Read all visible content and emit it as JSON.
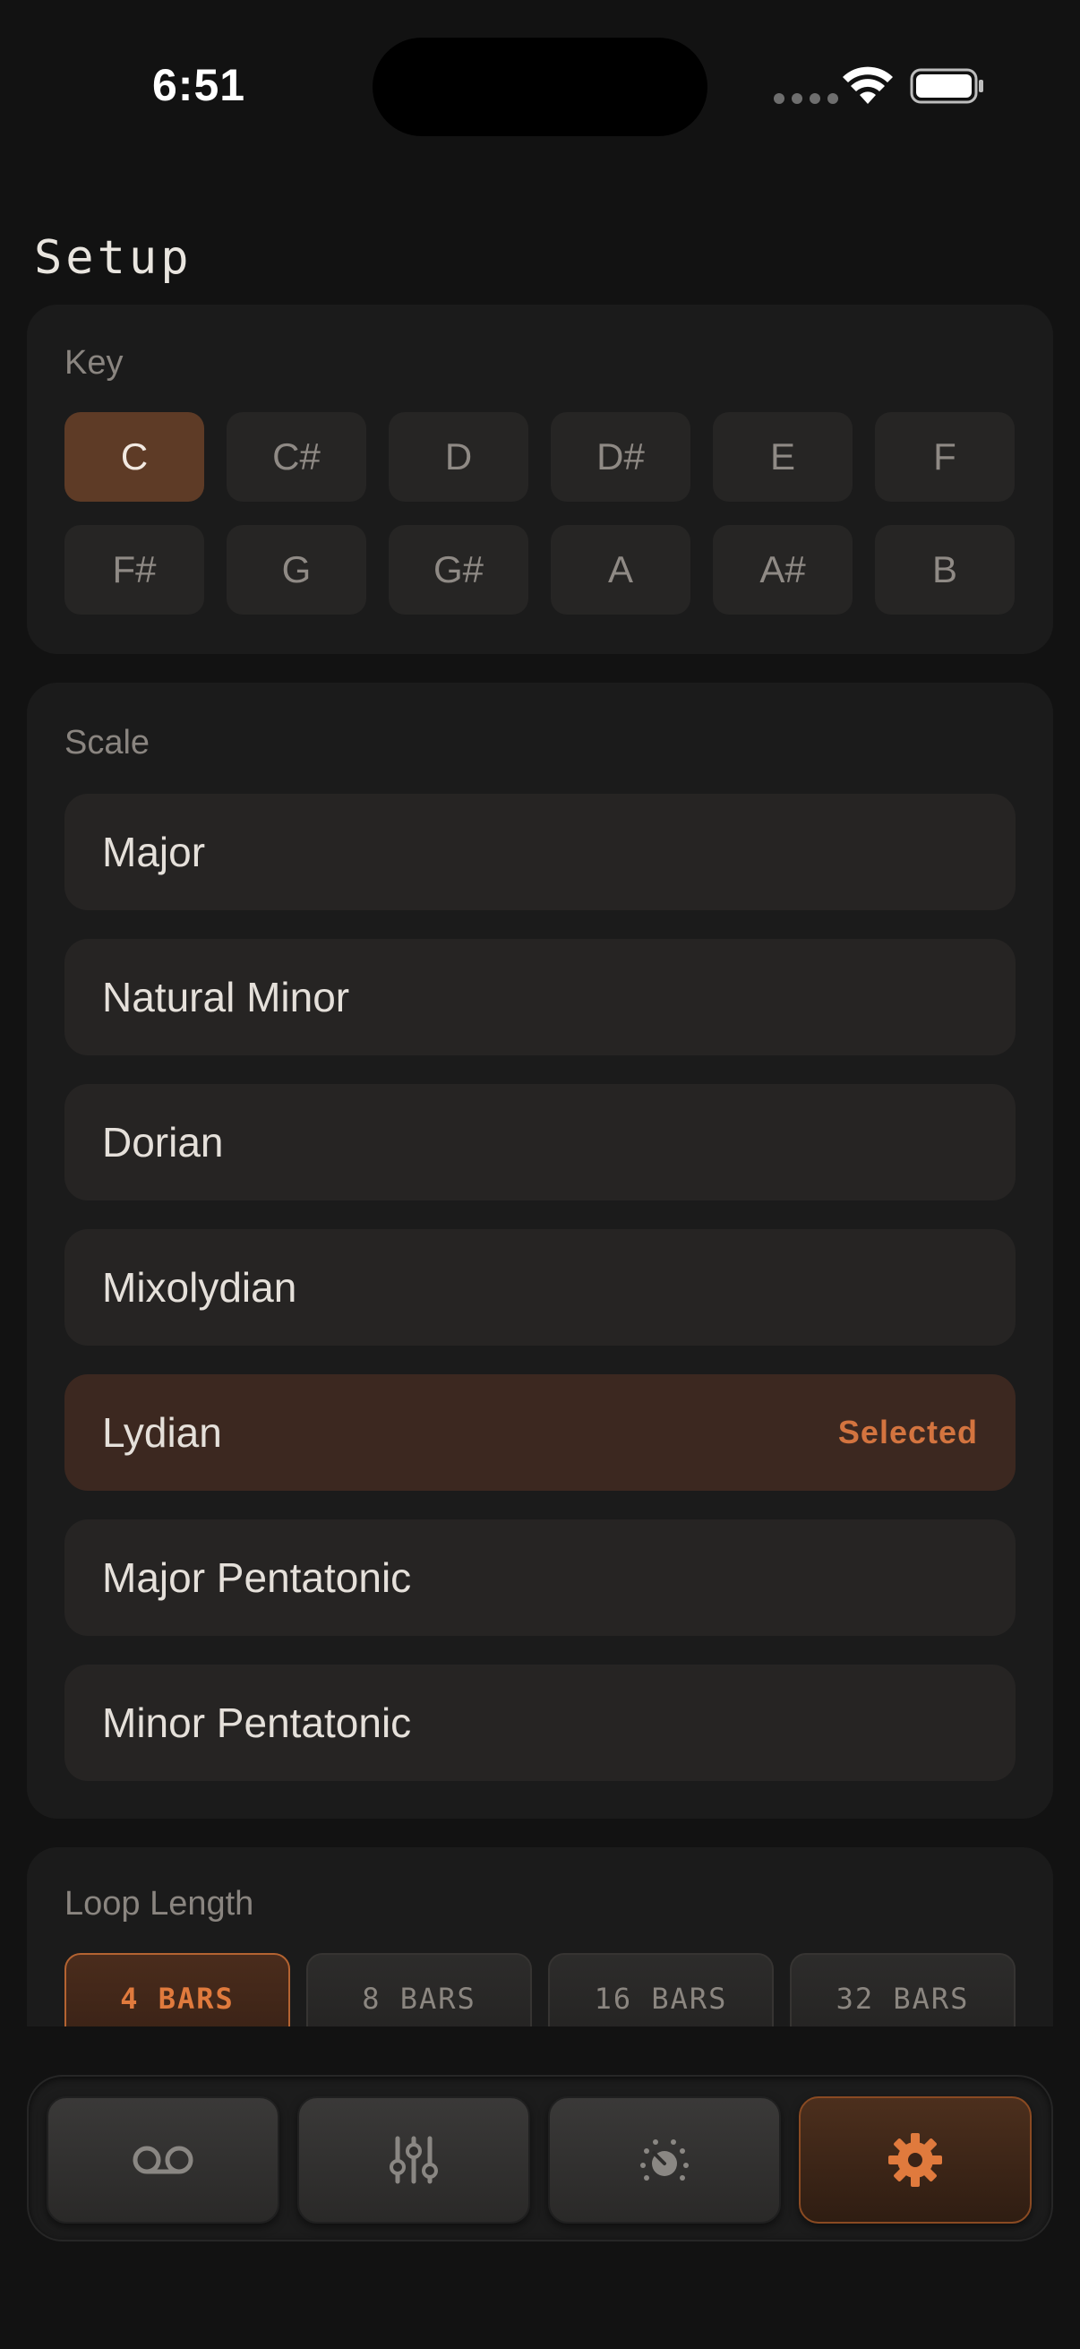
{
  "status_bar": {
    "time": "6:51"
  },
  "page": {
    "title": "Setup"
  },
  "key_section": {
    "label": "Key",
    "keys": [
      "C",
      "C#",
      "D",
      "D#",
      "E",
      "F",
      "F#",
      "G",
      "G#",
      "A",
      "A#",
      "B"
    ],
    "selected": "C"
  },
  "scale_section": {
    "label": "Scale",
    "scales": [
      "Major",
      "Natural Minor",
      "Dorian",
      "Mixolydian",
      "Lydian",
      "Major Pentatonic",
      "Minor Pentatonic"
    ],
    "selected": "Lydian",
    "selected_tag": "Selected"
  },
  "loop_section": {
    "label": "Loop Length",
    "options": [
      "4 BARS",
      "8 BARS",
      "16 BARS",
      "32 BARS"
    ],
    "selected": "4 BARS"
  },
  "tab_bar": {
    "tabs": [
      {
        "icon": "voicemail-icon"
      },
      {
        "icon": "sliders-icon"
      },
      {
        "icon": "dial-icon"
      },
      {
        "icon": "gear-icon"
      }
    ],
    "active_index": 3
  },
  "colors": {
    "accent": "#d3743f",
    "background": "#121212",
    "card": "#1b1b1b"
  }
}
